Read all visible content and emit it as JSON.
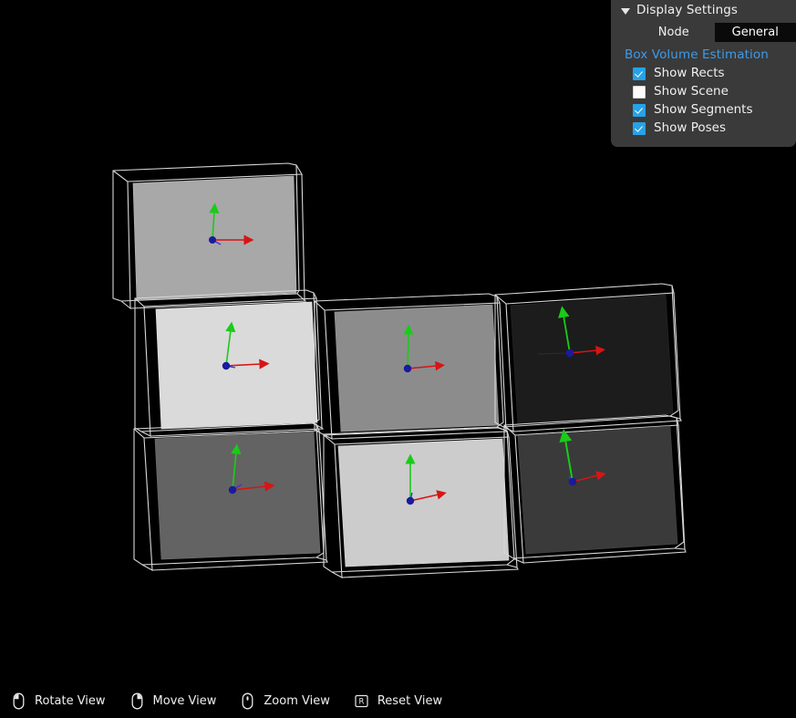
{
  "app": {
    "background_color": "#000000",
    "viewport_name": "3d-box-volume-viewport"
  },
  "display_settings": {
    "title": "Display Settings",
    "expanded": true,
    "disclosure_icon": "triangle-down-icon",
    "panel_bg": "#3a3a3a",
    "tabs": [
      {
        "label": "Node",
        "active": false
      },
      {
        "label": "General",
        "active": true
      }
    ],
    "section_header": "Box Volume Estimation",
    "section_header_color": "#3d9be9",
    "checkbox_accent": "#27a2e8",
    "options": [
      {
        "label": "Show Rects",
        "checked": true
      },
      {
        "label": "Show Scene",
        "checked": false
      },
      {
        "label": "Show Segments",
        "checked": true
      },
      {
        "label": "Show Poses",
        "checked": true
      }
    ]
  },
  "help_bar": {
    "items": [
      {
        "label": "Rotate View",
        "icon": "mouse-left-button-icon"
      },
      {
        "label": "Move View",
        "icon": "mouse-middle-button-icon"
      },
      {
        "label": "Zoom View",
        "icon": "mouse-scroll-wheel-icon"
      },
      {
        "label": "Reset View",
        "icon": "keyboard-key-r-icon"
      }
    ]
  },
  "scene": {
    "description": "Six wireframe 3D bounding boxes with shaded front faces and RGB pose axis markers",
    "wireframe_color": "#d8d8d8",
    "pose_axes": {
      "origin_color": "#1a1a9e",
      "x_axis_color": "#d81414",
      "y_axis_color": "#18cc18"
    },
    "boxes": [
      {
        "id": "box-top-left",
        "face_fill": "#a8a8a8",
        "has_pose": true
      },
      {
        "id": "box-mid-left",
        "face_fill": "#dadada",
        "has_pose": true
      },
      {
        "id": "box-mid-center",
        "face_fill": "#8c8c8c",
        "has_pose": true
      },
      {
        "id": "box-mid-right",
        "face_fill": "#1c1c1c",
        "has_pose": true
      },
      {
        "id": "box-bottom-left",
        "face_fill": "#636363",
        "has_pose": true
      },
      {
        "id": "box-bottom-center",
        "face_fill": "#cccccc",
        "has_pose": true
      },
      {
        "id": "box-bottom-right",
        "face_fill": "#3a3a3a",
        "has_pose": true
      }
    ]
  }
}
